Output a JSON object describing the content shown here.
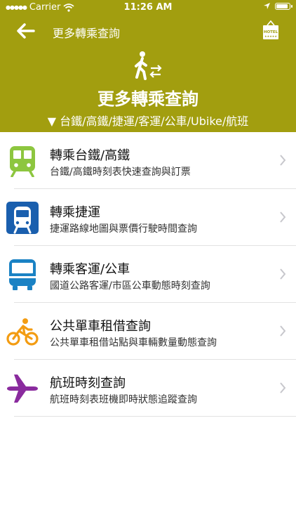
{
  "status": {
    "carrier": "Carrier",
    "time": "11:26 AM",
    "battery_level": 0.95
  },
  "nav": {
    "title": "更多轉乘查詢",
    "hotel_label": "HOTEL"
  },
  "hero": {
    "title": "更多轉乘查詢",
    "subtitle": "▼ 台鐵/高鐵/捷運/客運/公車/Ubike/航班"
  },
  "colors": {
    "header": "#a29e0f",
    "train": "#8dc63f",
    "metro": "#1a5fae",
    "bus": "#1a82c4",
    "bike": "#f39c12",
    "flight": "#8a2b9e"
  },
  "items": [
    {
      "title": "轉乘台鐵/高鐵",
      "desc": "台鐵/高鐵時刻表快速查詢與訂票",
      "icon": "train-icon"
    },
    {
      "title": "轉乘捷運",
      "desc": "捷運路線地圖與票價行駛時間查詢",
      "icon": "metro-icon"
    },
    {
      "title": "轉乘客運/公車",
      "desc": "國道公路客運/市區公車動態時刻查詢",
      "icon": "bus-icon"
    },
    {
      "title": "公共單車租借查詢",
      "desc": "公共單車租借站點與車輛數量動態查詢",
      "icon": "bicycle-icon"
    },
    {
      "title": "航班時刻查詢",
      "desc": "航班時刻表班機即時狀態追蹤查詢",
      "icon": "airplane-icon"
    }
  ]
}
